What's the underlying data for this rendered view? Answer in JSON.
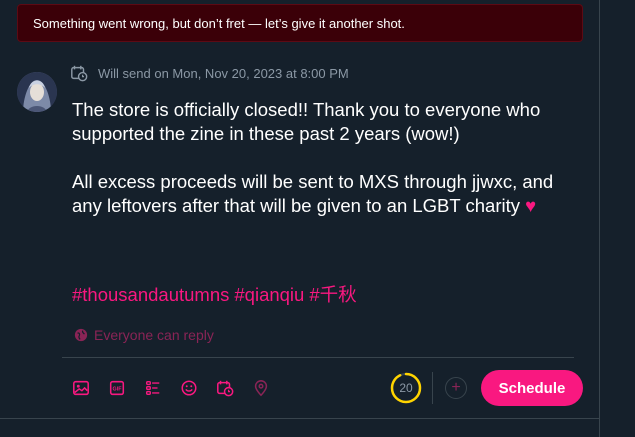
{
  "error_banner": {
    "message": "Something went wrong, but don’t fret — let’s give it another shot."
  },
  "composer": {
    "schedule_text": "Will send on Mon, Nov 20, 2023 at 8:00 PM",
    "paragraphs": [
      "The store is officially closed!! Thank you to everyone who supported the zine in these past 2 years (wow!)",
      "All excess proceeds will be sent to MXS through jjwxc, and any leftovers after that will be given to an LGBT charity"
    ],
    "emoji": "♥",
    "hashtags": [
      "#thousandautumns",
      "#qianqiu",
      "#千秋"
    ],
    "reply_setting": "Everyone can reply",
    "char_counter": "20",
    "char_progress": 0.93,
    "schedule_button": "Schedule",
    "add_button": "+"
  },
  "toolbar_icons": [
    "image-icon",
    "gif-icon",
    "poll-icon",
    "emoji-icon",
    "schedule-icon",
    "location-icon"
  ],
  "colors": {
    "accent": "#f91880",
    "background": "#15202b",
    "counter_warning": "#ffd400",
    "error_bg": "#3b0008"
  }
}
